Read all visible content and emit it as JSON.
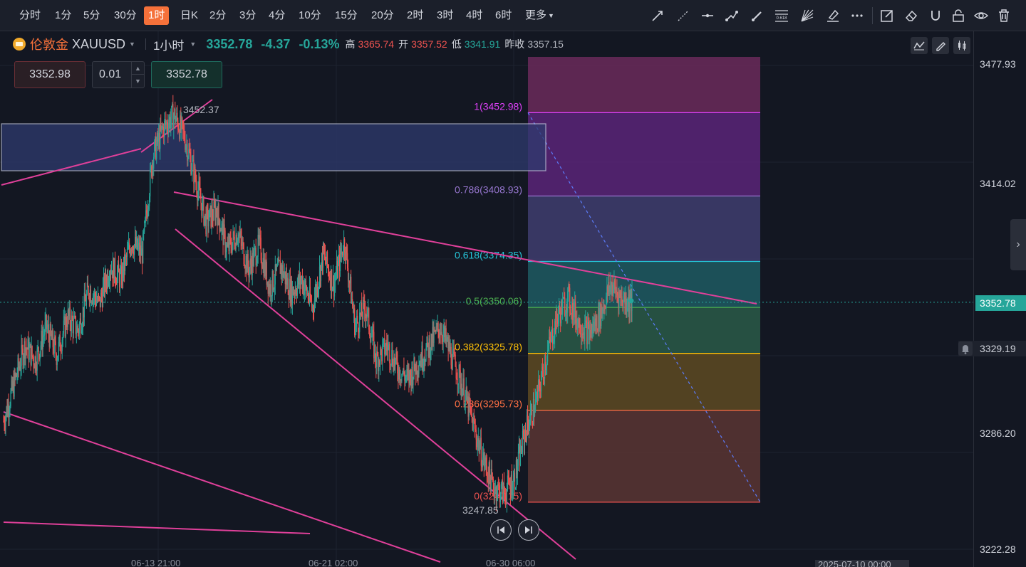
{
  "toolbar": {
    "timeframes": [
      "分时",
      "1分",
      "5分",
      "30分",
      "1时",
      "日K",
      "2分",
      "3分",
      "4分",
      "10分",
      "15分",
      "20分",
      "2时",
      "3时",
      "4时",
      "6时"
    ],
    "active_timeframe": "1时",
    "more_label": "更多",
    "drawing_tools": [
      "trend-line-icon",
      "ray-line-icon",
      "horizontal-line-icon",
      "polyline-icon",
      "brush-icon",
      "fibonacci-icon",
      "fan-icon",
      "highlighter-icon",
      "more-tools-icon",
      "edit-icon",
      "eraser-icon",
      "magnet-icon",
      "lock-icon",
      "eye-icon",
      "trash-icon"
    ],
    "fib_tool_text": "0.618"
  },
  "header": {
    "symbol_name": "伦敦金",
    "symbol_code": "XAUUSD",
    "interval": "1小时",
    "last_price": "3352.78",
    "change": "-4.37",
    "change_pct": "-0.13%",
    "high_label": "高",
    "high": "3365.74",
    "open_label": "开",
    "open": "3357.52",
    "low_label": "低",
    "low": "3341.91",
    "prev_close_label": "昨收",
    "prev_close": "3357.15"
  },
  "order": {
    "sell_price": "3352.98",
    "quantity": "0.01",
    "buy_price": "3352.78"
  },
  "price_scale": {
    "labels": [
      {
        "text": "3477.93",
        "color": "#ef5350"
      },
      {
        "text": "3414.02",
        "color": "#ef5350"
      },
      {
        "text": "3286.20",
        "color": "#26a69a"
      },
      {
        "text": "3222.28",
        "color": "#26a69a"
      }
    ],
    "last_price_tag": "3352.78",
    "alert_price": "3329.19"
  },
  "time_axis": {
    "labels": [
      "06-13 21:00",
      "06-21 02:00",
      "06-30 06:00"
    ],
    "cursor_label": "2025-07-10 00:00"
  },
  "annotations": {
    "swing_high": "3452.37",
    "swing_low": "3247.85"
  },
  "fibonacci": {
    "levels": [
      {
        "label": "1(3452.98)",
        "ratio": 1,
        "color": "#e040fb"
      },
      {
        "label": "0.786(3408.93)",
        "ratio": 0.786,
        "color": "#9575cd"
      },
      {
        "label": "0.618(3374.35)",
        "ratio": 0.618,
        "color": "#26c6da"
      },
      {
        "label": "0.5(3350.06)",
        "ratio": 0.5,
        "color": "#4caf50"
      },
      {
        "label": "0.382(3325.78)",
        "ratio": 0.382,
        "color": "#ffc107"
      },
      {
        "label": "0.236(3295.73)",
        "ratio": 0.236,
        "color": "#ff7043"
      },
      {
        "label": "0(3247.15)",
        "ratio": 0,
        "color": "#ef5350"
      }
    ]
  },
  "colors": {
    "up": "#26a69a",
    "down": "#ef5350",
    "accent": "#f5713a",
    "trendline": "#e0409a",
    "background": "#131722"
  },
  "chart_data": {
    "type": "line",
    "symbol": "XAUUSD",
    "interval": "1小时",
    "x_labels": [
      "06-13 21:00",
      "06-21 02:00",
      "06-30 06:00"
    ],
    "ylim": [
      3222.28,
      3477.93
    ],
    "ytick_labels": [
      "3222.28",
      "3286.20",
      "3414.02",
      "3477.93"
    ],
    "series": [
      {
        "values": [
          3290,
          3310,
          3330,
          3322,
          3340,
          3325,
          3345,
          3338,
          3360,
          3352,
          3372,
          3365,
          3385,
          3378,
          3430,
          3445,
          3452,
          3440,
          3418,
          3395,
          3402,
          3380,
          3390,
          3370,
          3383,
          3360,
          3372,
          3358,
          3365,
          3350,
          3378,
          3362,
          3385,
          3340,
          3350,
          3322,
          3330,
          3318,
          3312,
          3322,
          3330,
          3340,
          3325,
          3310,
          3290,
          3270,
          3255,
          3252,
          3260,
          3285,
          3300,
          3325,
          3345,
          3355,
          3342,
          3336,
          3346,
          3362,
          3355,
          3352.78
        ]
      }
    ],
    "fib_retracement": {
      "from": 3452.98,
      "to": 3247.15
    }
  }
}
